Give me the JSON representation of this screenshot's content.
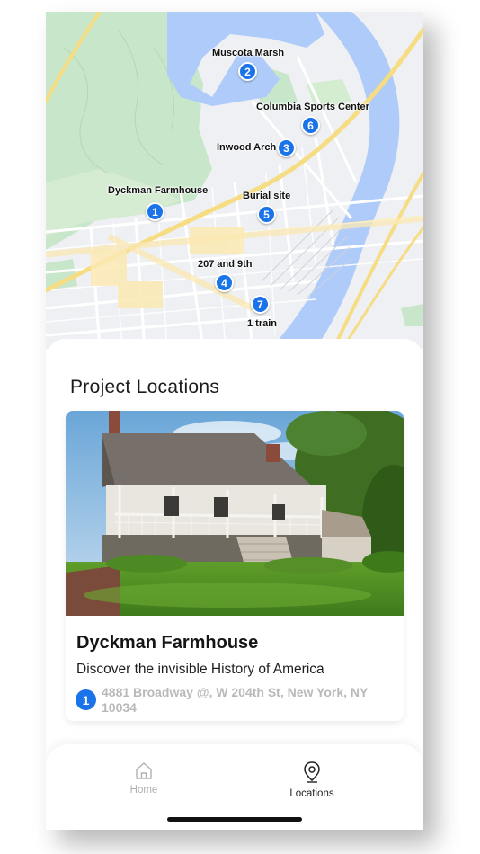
{
  "map": {
    "pins": [
      {
        "number": "2",
        "label": "Muscota Marsh"
      },
      {
        "number": "6",
        "label": "Columbia Sports Center"
      },
      {
        "number": "3",
        "label": "Inwood Arch"
      },
      {
        "number": "1",
        "label": "Dyckman Farmhouse"
      },
      {
        "number": "5",
        "label": "Burial site"
      },
      {
        "number": "4",
        "label": "207 and 9th"
      },
      {
        "number": "7",
        "label": "1 train"
      }
    ]
  },
  "sheet": {
    "title": "Project Locations",
    "card": {
      "name": "Dyckman Farmhouse",
      "tagline": "Discover the invisible History of America",
      "badge": "1",
      "address": "4881 Broadway @, W 204th St, New York, NY 10034"
    }
  },
  "tabbar": {
    "tabs": [
      {
        "label": "Home",
        "icon": "home-icon",
        "active": false
      },
      {
        "label": "Locations",
        "icon": "location-pin-icon",
        "active": true
      }
    ]
  },
  "colors": {
    "accent": "#1a73e8",
    "water": "#aecbfa",
    "park": "#c8e6c9",
    "inactive_tab": "#b0b0b0"
  }
}
